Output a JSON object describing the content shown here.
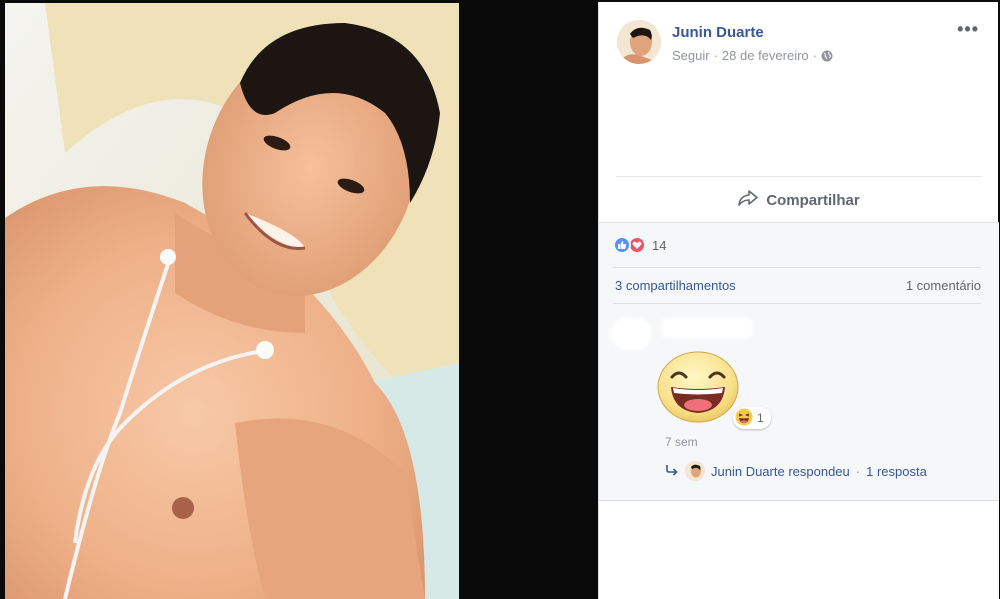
{
  "post": {
    "author": "Junin Duarte",
    "follow_label": "Seguir",
    "separator": "·",
    "date": "28 de fevereiro",
    "audience_icon": "globe-icon",
    "more_icon": "more-options-icon",
    "more_glyph": "•••"
  },
  "actions": {
    "share_label": "Compartilhar",
    "share_icon": "share-arrow-icon"
  },
  "feedback": {
    "reaction_icons": [
      "like-reaction-icon",
      "love-reaction-icon"
    ],
    "reaction_count": "14",
    "shares_label": "3 compartilhamentos",
    "comments_label": "1 comentário"
  },
  "comment": {
    "sticker_icon": "laughing-face-sticker",
    "reaction_icon": "haha-reaction-icon",
    "reaction_count": "1",
    "time": "7 sem",
    "reply_icon": "reply-arrow-icon",
    "reply_author_text": "Junin Duarte respondeu",
    "reply_separator": "·",
    "reply_count": "1 resposta"
  },
  "colors": {
    "link_blue": "#365899",
    "meta_gray": "#90949c",
    "like_blue": "#5890ff",
    "love_red": "#f25268",
    "feedback_bg": "#f6f7f9"
  }
}
